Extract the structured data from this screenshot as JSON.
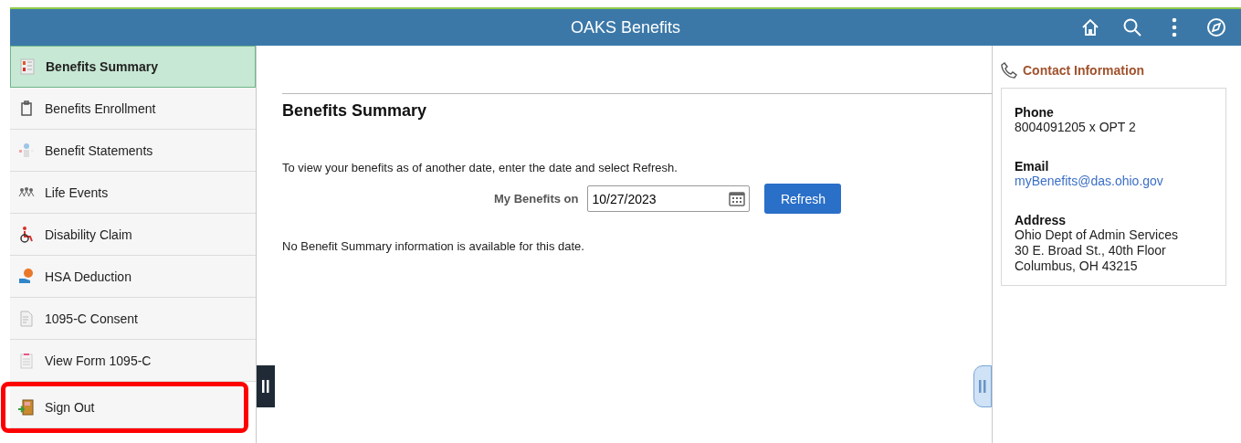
{
  "header": {
    "title": "OAKS Benefits"
  },
  "sidebar": {
    "items": [
      {
        "label": "Benefits Summary",
        "kind": "summary",
        "selected": true,
        "highlighted": false
      },
      {
        "label": "Benefits Enrollment",
        "kind": "clipboard",
        "selected": false,
        "highlighted": false
      },
      {
        "label": "Benefit Statements",
        "kind": "statement",
        "selected": false,
        "highlighted": false
      },
      {
        "label": "Life Events",
        "kind": "people",
        "selected": false,
        "highlighted": false
      },
      {
        "label": "Disability Claim",
        "kind": "wheelchair",
        "selected": false,
        "highlighted": false
      },
      {
        "label": "HSA Deduction",
        "kind": "hsa",
        "selected": false,
        "highlighted": false
      },
      {
        "label": "1095-C Consent",
        "kind": "document",
        "selected": false,
        "highlighted": false
      },
      {
        "label": "View Form 1095-C",
        "kind": "form",
        "selected": false,
        "highlighted": false
      },
      {
        "label": "Sign Out",
        "kind": "door",
        "selected": false,
        "highlighted": true
      }
    ]
  },
  "main": {
    "title": "Benefits Summary",
    "instructions": "To view your benefits as of another date, enter the date and select Refresh.",
    "date_label": "My Benefits on",
    "date_value": "10/27/2023",
    "refresh_button": "Refresh",
    "message": "No Benefit Summary information is available for this date."
  },
  "contact": {
    "title": "Contact Information",
    "sections": [
      {
        "label": "Phone",
        "kind": "text",
        "lines": [
          "8004091205 x OPT 2"
        ]
      },
      {
        "label": "Email",
        "kind": "link",
        "lines": [
          "myBenefits@das.ohio.gov"
        ]
      },
      {
        "label": "Address",
        "kind": "text",
        "lines": [
          "Ohio Dept of Admin Services",
          "30 E. Broad St., 40th Floor",
          "Columbus, OH 43215"
        ]
      }
    ]
  }
}
